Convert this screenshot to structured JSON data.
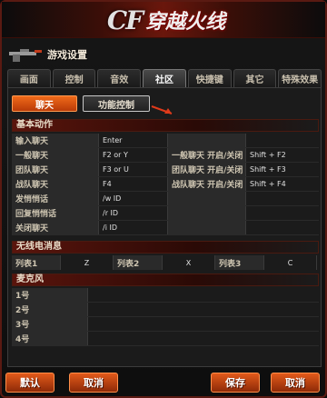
{
  "logo": {
    "cf": "CF",
    "cn": "穿越火线"
  },
  "title": "游戏设置",
  "tabs": [
    "画面",
    "控制",
    "音效",
    "社区",
    "快捷键",
    "其它",
    "特殊效果"
  ],
  "active_tab": "社区",
  "sub_tabs": {
    "chat": "聊天",
    "function": "功能控制"
  },
  "basic_actions": {
    "header": "基本动作",
    "rows": [
      {
        "label": "输入聊天",
        "key": "Enter",
        "label2": "",
        "key2": ""
      },
      {
        "label": "一般聊天",
        "key": "F2 or Y",
        "label2": "一般聊天 开启/关闭",
        "key2": "Shift + F2"
      },
      {
        "label": "团队聊天",
        "key": "F3 or U",
        "label2": "团队聊天 开启/关闭",
        "key2": "Shift + F3"
      },
      {
        "label": "战队聊天",
        "key": "F4",
        "label2": "战队聊天 开启/关闭",
        "key2": "Shift + F4"
      },
      {
        "label": "发悄悄话",
        "key": "/w ID",
        "label2": "",
        "key2": ""
      },
      {
        "label": "回复悄悄话",
        "key": "/r ID",
        "label2": "",
        "key2": ""
      },
      {
        "label": "关闭聊天",
        "key": "/i ID",
        "label2": "",
        "key2": ""
      }
    ]
  },
  "radio": {
    "header": "无线电消息",
    "items": [
      {
        "label": "列表1",
        "key": "Z"
      },
      {
        "label": "列表2",
        "key": "X"
      },
      {
        "label": "列表3",
        "key": "C"
      }
    ]
  },
  "mic": {
    "header": "麦克风",
    "rows": [
      "1号",
      "2号",
      "3号",
      "4号"
    ]
  },
  "buttons": {
    "default": "默认",
    "cancel_left": "取消",
    "save": "保存",
    "cancel": "取消"
  }
}
